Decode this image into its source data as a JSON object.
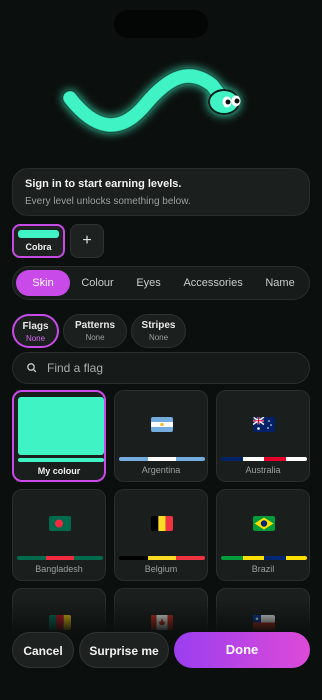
{
  "signin": {
    "title": "Sign in to start earning levels.",
    "subtitle": "Every level unlocks something below."
  },
  "snake": {
    "body_color": "#3ff3c4"
  },
  "slots": [
    {
      "label": "Cobra",
      "color": "#3ff3c4",
      "selected": true
    }
  ],
  "add_slot_label": "+",
  "tabs": [
    {
      "label": "Skin",
      "active": true
    },
    {
      "label": "Colour",
      "active": false
    },
    {
      "label": "Eyes",
      "active": false
    },
    {
      "label": "Accessories",
      "active": false
    },
    {
      "label": "Name",
      "active": false
    }
  ],
  "chips": [
    {
      "label": "Flags",
      "value": "None",
      "active": true
    },
    {
      "label": "Patterns",
      "value": "None",
      "active": false
    },
    {
      "label": "Stripes",
      "value": "None",
      "active": false
    }
  ],
  "search": {
    "placeholder": "Find a flag",
    "value": ""
  },
  "flags": [
    {
      "name": "My colour",
      "selected": true,
      "icon": "my-colour-swatch",
      "bar": [
        "#3ff3c4"
      ]
    },
    {
      "name": "Argentina",
      "selected": false,
      "icon": "argentina-flag-icon",
      "bar": [
        "#74acdf",
        "#ffffff",
        "#74acdf"
      ]
    },
    {
      "name": "Australia",
      "selected": false,
      "icon": "australia-flag-icon",
      "bar": [
        "#012169",
        "#ffffff",
        "#e4002b",
        "#ffffff"
      ]
    },
    {
      "name": "Bangladesh",
      "selected": false,
      "icon": "bangladesh-flag-icon",
      "bar": [
        "#006a4e",
        "#f42a41",
        "#006a4e"
      ]
    },
    {
      "name": "Belgium",
      "selected": false,
      "icon": "belgium-flag-icon",
      "bar": [
        "#000000",
        "#fdda24",
        "#ef3340"
      ]
    },
    {
      "name": "Brazil",
      "selected": false,
      "icon": "brazil-flag-icon",
      "bar": [
        "#009c3b",
        "#ffdf00",
        "#002776",
        "#ffdf00"
      ]
    },
    {
      "name": "",
      "selected": false,
      "icon": "cameroon-flag-icon",
      "bar": []
    },
    {
      "name": "",
      "selected": false,
      "icon": "canada-flag-icon",
      "bar": []
    },
    {
      "name": "",
      "selected": false,
      "icon": "chile-flag-icon",
      "bar": []
    }
  ],
  "buttons": {
    "cancel": "Cancel",
    "surprise": "Surprise me",
    "done": "Done"
  },
  "colors": {
    "accent": "#c84ae8",
    "snake": "#3ff3c4",
    "background": "#0b0f0d"
  }
}
